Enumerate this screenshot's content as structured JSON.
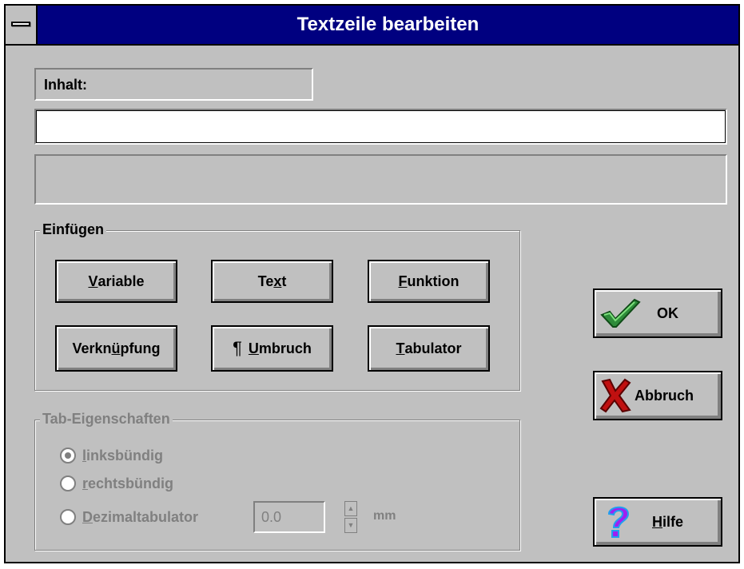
{
  "window": {
    "title": "Textzeile bearbeiten"
  },
  "inhalt": {
    "label": "Inhalt:",
    "value": ""
  },
  "einfuegen": {
    "title": "Einfügen",
    "variable": {
      "pre": "",
      "u": "V",
      "post": "ariable"
    },
    "text": {
      "pre": "Te",
      "u": "x",
      "post": "t"
    },
    "funktion": {
      "pre": "",
      "u": "F",
      "post": "unktion"
    },
    "verknuepfung": {
      "pre": "Verkn",
      "u": "ü",
      "post": "pfung"
    },
    "umbruch": {
      "symbol": "¶",
      "pre": "",
      "u": "U",
      "post": "mbruch"
    },
    "tabulator": {
      "pre": "",
      "u": "T",
      "post": "abulator"
    }
  },
  "tab_props": {
    "title": "Tab-Eigenschaften",
    "linksbuendig": {
      "pre": "",
      "u": "l",
      "post": "inksbündig",
      "checked": true
    },
    "rechtsbuendig": {
      "pre": "",
      "u": "r",
      "post": "echtsbündig",
      "checked": false
    },
    "dezimal": {
      "pre": "",
      "u": "D",
      "post": "ezimaltabulator",
      "checked": false
    },
    "dezimal_value": "0.0",
    "unit": "mm"
  },
  "actions": {
    "ok": "OK",
    "abbruch": "Abbruch",
    "hilfe": {
      "pre": "",
      "u": "H",
      "post": "ilfe"
    }
  },
  "colors": {
    "titlebar": "#000080",
    "face": "#c0c0c0",
    "disabled": "#808080",
    "check": "#2e8b3a",
    "cross": "#c01010",
    "help": "#a020f0"
  },
  "icons": {
    "ok": "checkmark-icon",
    "abbruch": "x-cross-icon",
    "hilfe": "question-mark-icon",
    "system": "system-menu-icon"
  }
}
